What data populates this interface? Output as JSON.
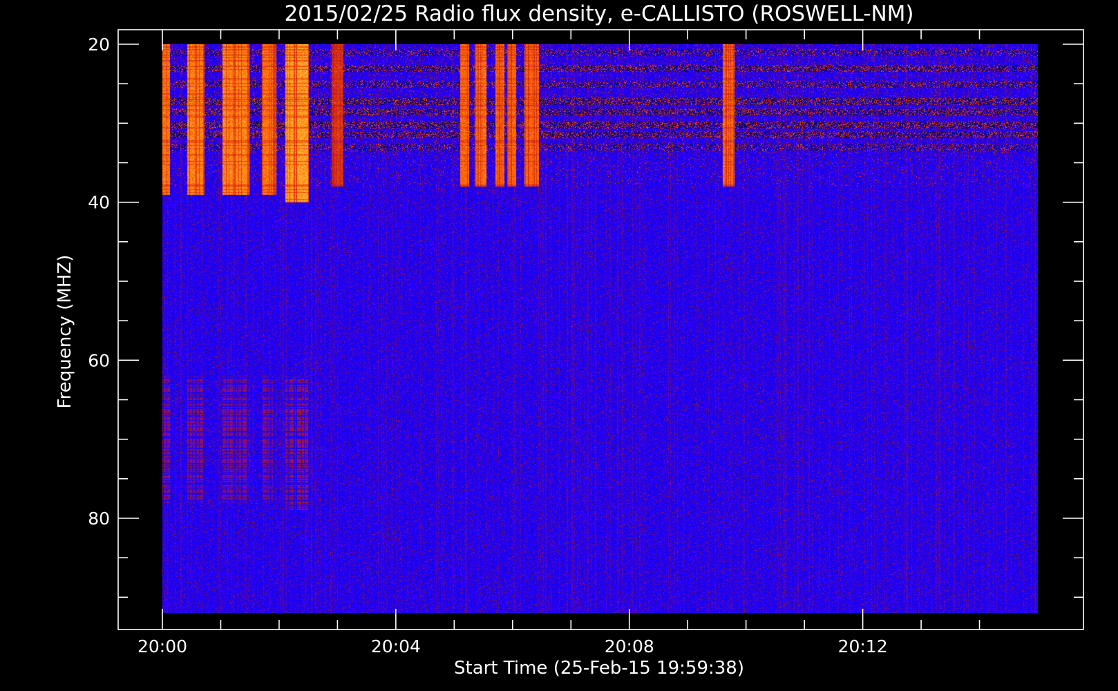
{
  "chart_data": {
    "type": "heatmap",
    "title": "2015/02/25  Radio flux density, e-CALLISTO (ROSWELL-NM)",
    "xlabel": "Start Time (25-Feb-15 19:59:38)",
    "ylabel": "Frequency (MHZ)",
    "x_range_minutes": [
      0,
      15
    ],
    "x_ticks": [
      {
        "minute": 0,
        "label": "20:00"
      },
      {
        "minute": 4,
        "label": "20:04"
      },
      {
        "minute": 8,
        "label": "20:08"
      },
      {
        "minute": 12,
        "label": "20:12"
      }
    ],
    "x_minor_tick_minutes": [
      1,
      2,
      3,
      5,
      6,
      7,
      9,
      10,
      11,
      13,
      14
    ],
    "y_range": [
      92.3,
      20
    ],
    "y_axis_inverted": true,
    "y_ticks": [
      20,
      40,
      60,
      80
    ],
    "y_minor_ticks": [
      25,
      30,
      35,
      45,
      50,
      55,
      65,
      70,
      75,
      85,
      90
    ],
    "data_extent": {
      "time_minutes": [
        0,
        15
      ],
      "frequency_mhz": [
        20,
        92
      ]
    },
    "colormap": [
      "#000000",
      "#1a00ff",
      "#c01a1a",
      "#ff5a00",
      "#ffee55"
    ],
    "background_color": "#1a00ff",
    "burst_columns": [
      {
        "start_min": 0.0,
        "end_min": 0.12,
        "freq_top": 20,
        "freq_bottom": 39,
        "intensity": 0.85
      },
      {
        "start_min": 0.42,
        "end_min": 0.72,
        "freq_top": 20,
        "freq_bottom": 39,
        "intensity": 0.9
      },
      {
        "start_min": 1.02,
        "end_min": 1.48,
        "freq_top": 20,
        "freq_bottom": 39,
        "intensity": 0.92
      },
      {
        "start_min": 1.7,
        "end_min": 1.95,
        "freq_top": 20,
        "freq_bottom": 39,
        "intensity": 0.85
      },
      {
        "start_min": 2.1,
        "end_min": 2.5,
        "freq_top": 20,
        "freq_bottom": 40,
        "intensity": 1.0
      },
      {
        "start_min": 5.1,
        "end_min": 5.25,
        "freq_top": 20,
        "freq_bottom": 38,
        "intensity": 0.8
      },
      {
        "start_min": 5.35,
        "end_min": 5.55,
        "freq_top": 20,
        "freq_bottom": 38,
        "intensity": 0.85
      },
      {
        "start_min": 5.7,
        "end_min": 5.85,
        "freq_top": 20,
        "freq_bottom": 38,
        "intensity": 0.8
      },
      {
        "start_min": 5.9,
        "end_min": 6.05,
        "freq_top": 20,
        "freq_bottom": 38,
        "intensity": 0.8
      },
      {
        "start_min": 6.2,
        "end_min": 6.45,
        "freq_top": 20,
        "freq_bottom": 38,
        "intensity": 0.8
      },
      {
        "start_min": 9.6,
        "end_min": 9.8,
        "freq_top": 20,
        "freq_bottom": 38,
        "intensity": 0.8
      },
      {
        "start_min": 2.9,
        "end_min": 3.1,
        "freq_top": 20,
        "freq_bottom": 38,
        "intensity": 0.5
      }
    ],
    "low_freq_bursts": [
      {
        "start_min": 0.0,
        "end_min": 0.12,
        "freq_top": 62,
        "freq_bottom": 78,
        "intensity": 0.55
      },
      {
        "start_min": 0.42,
        "end_min": 0.72,
        "freq_top": 62,
        "freq_bottom": 78,
        "intensity": 0.5
      },
      {
        "start_min": 1.02,
        "end_min": 1.48,
        "freq_top": 62,
        "freq_bottom": 78,
        "intensity": 0.5
      },
      {
        "start_min": 1.7,
        "end_min": 1.95,
        "freq_top": 62,
        "freq_bottom": 78,
        "intensity": 0.45
      },
      {
        "start_min": 2.1,
        "end_min": 2.5,
        "freq_top": 62,
        "freq_bottom": 79,
        "intensity": 0.65
      }
    ],
    "rfi_bands_mhz": [
      {
        "freq": 21,
        "strength": 0.6
      },
      {
        "freq": 23,
        "strength": 0.9
      },
      {
        "freq": 25,
        "strength": 0.7
      },
      {
        "freq": 27.2,
        "strength": 1.0
      },
      {
        "freq": 28.5,
        "strength": 0.9
      },
      {
        "freq": 30.2,
        "strength": 1.0
      },
      {
        "freq": 31.4,
        "strength": 0.9
      },
      {
        "freq": 33,
        "strength": 0.6
      },
      {
        "freq": 39.7,
        "strength": 0.5
      }
    ],
    "grid": false
  }
}
